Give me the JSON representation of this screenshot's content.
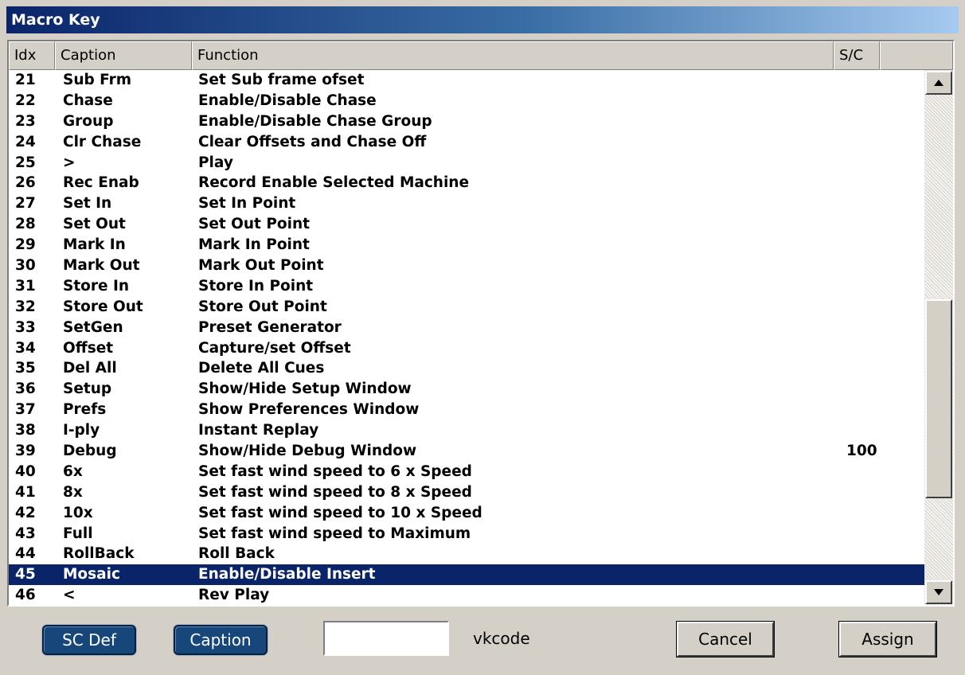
{
  "window": {
    "title": "Macro Key"
  },
  "table": {
    "columns": [
      "Idx",
      "Caption",
      "Function",
      "S/C"
    ],
    "rows": [
      {
        "idx": "21",
        "caption": "Sub Frm",
        "function": "Set Sub frame ofset",
        "sc": ""
      },
      {
        "idx": "22",
        "caption": "Chase",
        "function": "Enable/Disable Chase",
        "sc": ""
      },
      {
        "idx": "23",
        "caption": "Group",
        "function": "Enable/Disable Chase Group",
        "sc": ""
      },
      {
        "idx": "24",
        "caption": "Clr Chase",
        "function": "Clear Offsets and Chase Off",
        "sc": ""
      },
      {
        "idx": "25",
        "caption": ">",
        "function": "Play",
        "sc": ""
      },
      {
        "idx": "26",
        "caption": "Rec Enab",
        "function": "Record Enable Selected Machine",
        "sc": ""
      },
      {
        "idx": "27",
        "caption": "Set In",
        "function": "Set In Point",
        "sc": ""
      },
      {
        "idx": "28",
        "caption": "Set Out",
        "function": "Set Out Point",
        "sc": ""
      },
      {
        "idx": "29",
        "caption": "Mark In",
        "function": "Mark In Point",
        "sc": ""
      },
      {
        "idx": "30",
        "caption": "Mark Out",
        "function": "Mark Out Point",
        "sc": ""
      },
      {
        "idx": "31",
        "caption": "Store In",
        "function": "Store In Point",
        "sc": ""
      },
      {
        "idx": "32",
        "caption": "Store Out",
        "function": "Store Out Point",
        "sc": ""
      },
      {
        "idx": "33",
        "caption": "SetGen",
        "function": "Preset Generator",
        "sc": ""
      },
      {
        "idx": "34",
        "caption": "Offset",
        "function": "Capture/set Offset",
        "sc": ""
      },
      {
        "idx": "35",
        "caption": "Del All",
        "function": "Delete All Cues",
        "sc": ""
      },
      {
        "idx": "36",
        "caption": "Setup",
        "function": "Show/Hide Setup Window",
        "sc": ""
      },
      {
        "idx": "37",
        "caption": "Prefs",
        "function": "Show Preferences Window",
        "sc": ""
      },
      {
        "idx": "38",
        "caption": "I-ply",
        "function": "Instant Replay",
        "sc": ""
      },
      {
        "idx": "39",
        "caption": "Debug",
        "function": "Show/Hide Debug Window",
        "sc": "100"
      },
      {
        "idx": "40",
        "caption": "6x",
        "function": "Set fast wind speed to 6 x Speed",
        "sc": ""
      },
      {
        "idx": "41",
        "caption": "8x",
        "function": "Set fast wind speed to 8 x Speed",
        "sc": ""
      },
      {
        "idx": "42",
        "caption": "10x",
        "function": "Set fast wind speed to 10 x Speed",
        "sc": ""
      },
      {
        "idx": "43",
        "caption": "Full",
        "function": "Set fast wind speed to Maximum",
        "sc": ""
      },
      {
        "idx": "44",
        "caption": "RollBack",
        "function": "Roll Back",
        "sc": ""
      },
      {
        "idx": "45",
        "caption": "Mosaic",
        "function": "Enable/Disable Insert",
        "sc": "",
        "selected": true
      },
      {
        "idx": "46",
        "caption": "<",
        "function": "Rev Play",
        "sc": ""
      }
    ]
  },
  "scrollbar": {
    "up_icon": "triangle-up",
    "down_icon": "triangle-down"
  },
  "buttons": {
    "sc_def": "SC Def",
    "caption": "Caption",
    "cancel": "Cancel",
    "assign": "Assign"
  },
  "vkcode": {
    "label": "vkcode",
    "value": ""
  },
  "colors": {
    "selection": "#0a246a",
    "title_start": "#0a246a",
    "title_end": "#a6caf0"
  }
}
